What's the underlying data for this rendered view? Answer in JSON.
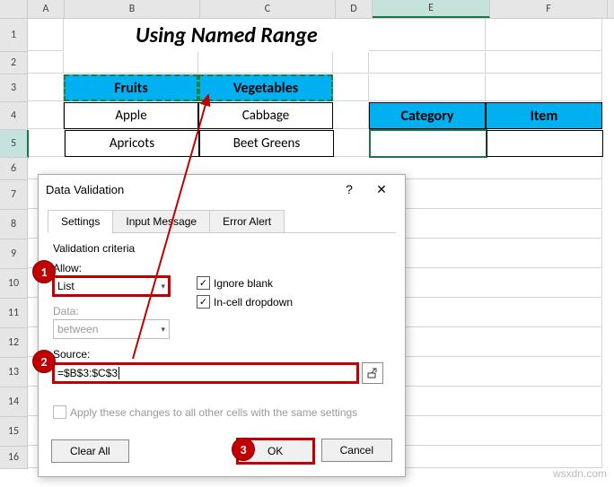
{
  "columns": {
    "A": "A",
    "B": "B",
    "C": "C",
    "D": "D",
    "E": "E",
    "F": "F"
  },
  "rows": [
    "1",
    "2",
    "3",
    "4",
    "5",
    "6",
    "7",
    "8",
    "9",
    "10",
    "11",
    "12",
    "13",
    "14",
    "15",
    "16"
  ],
  "title": "Using Named Range",
  "table1": {
    "headers": [
      "Fruits",
      "Vegetables"
    ],
    "rows": [
      [
        "Apple",
        "Cabbage"
      ],
      [
        "Apricots",
        "Beet Greens"
      ]
    ]
  },
  "table2": {
    "headers": [
      "Category",
      "Item"
    ]
  },
  "dialog": {
    "title": "Data Validation",
    "tabs": [
      "Settings",
      "Input Message",
      "Error Alert"
    ],
    "criteria_label": "Validation criteria",
    "allow_label": "Allow:",
    "allow_value": "List",
    "data_label": "Data:",
    "data_value": "between",
    "ignore_blank": "Ignore blank",
    "incell_dropdown": "In-cell dropdown",
    "source_label": "Source:",
    "source_value": "=$B$3:$C$3",
    "apply_label": "Apply these changes to all other cells with the same settings",
    "clear_all": "Clear All",
    "ok": "OK",
    "cancel": "Cancel"
  },
  "callouts": {
    "c1": "1",
    "c2": "2",
    "c3": "3"
  },
  "watermark": "wsxdn.com"
}
